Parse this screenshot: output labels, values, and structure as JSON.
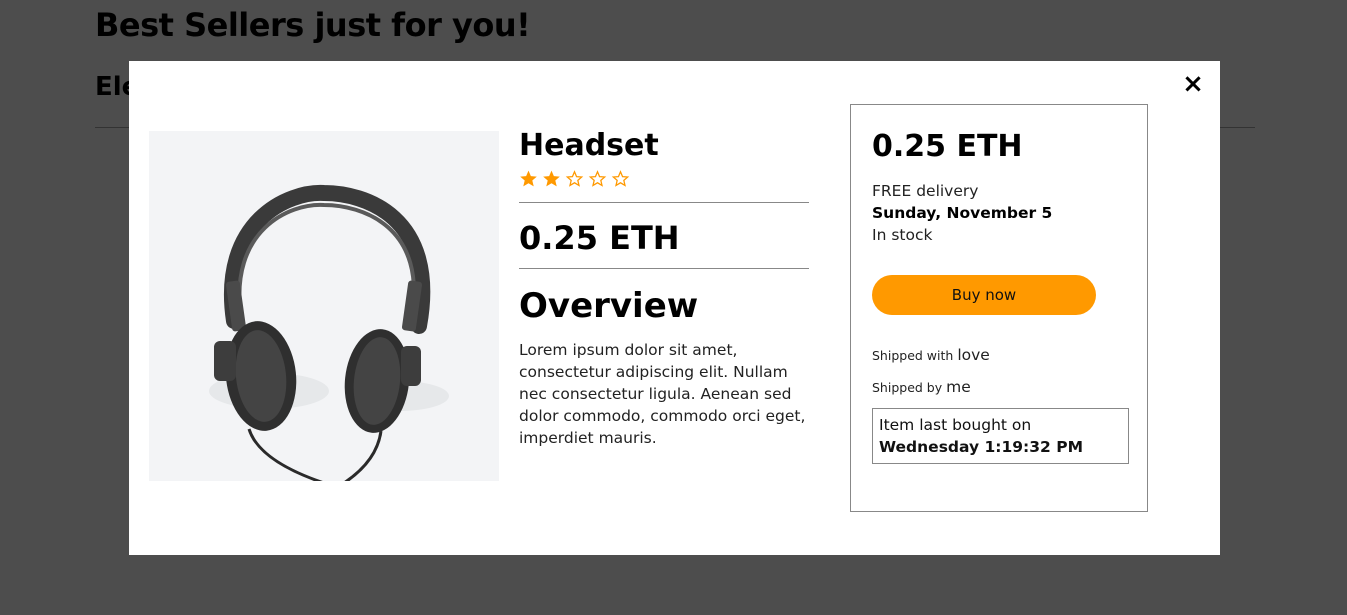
{
  "page": {
    "heading": "Best Sellers just for you!",
    "section_heading": "Ele"
  },
  "modal": {
    "close_icon": "×",
    "product": {
      "image_icon": "headphones-product-photo",
      "title": "Headset",
      "rating": {
        "value": 2,
        "max": 5,
        "color": "#ff9900"
      },
      "price": "0.25 ETH",
      "overview_title": "Overview",
      "overview_text": "Lorem ipsum dolor sit amet, consectetur adipiscing elit. Nullam nec consectetur ligula. Aenean sed dolor commodo, commodo orci eget, imperdiet mauris."
    },
    "buybox": {
      "price": "0.25 ETH",
      "delivery_label": "FREE delivery",
      "delivery_date": "Sunday, November 5",
      "stock": "In stock",
      "buy_button": "Buy now",
      "shipped_with_label": "Shipped with",
      "shipped_with_value": "love",
      "shipped_by_label": "Shipped by",
      "shipped_by_value": "me",
      "last_bought_label": "Item last bought on",
      "last_bought_value": "Wednesday 1:19:32 PM",
      "accent_color": "#ff9900"
    }
  }
}
